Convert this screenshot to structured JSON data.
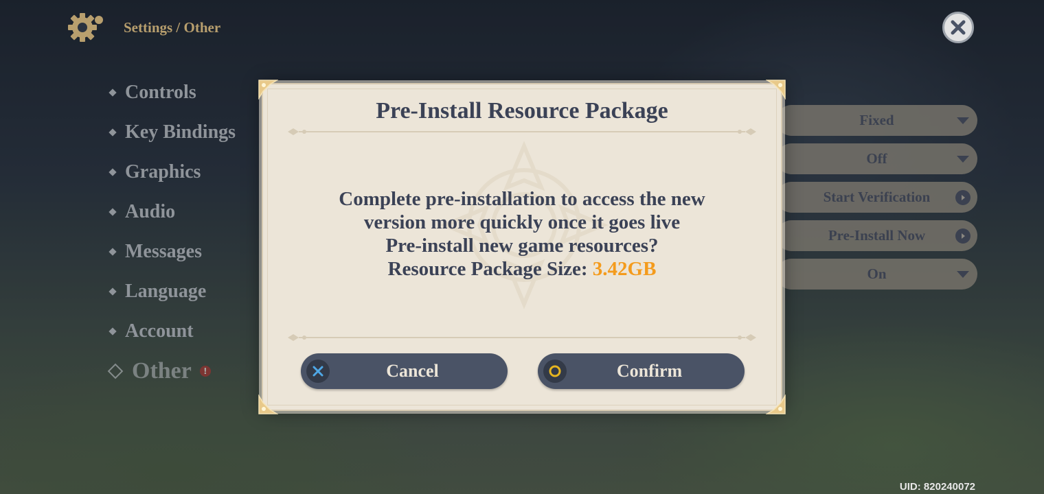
{
  "header": {
    "breadcrumb": "Settings / Other",
    "icon": "gear-icon",
    "close_icon": "close-icon"
  },
  "sidebar": {
    "items": [
      {
        "label": "Controls"
      },
      {
        "label": "Key Bindings"
      },
      {
        "label": "Graphics"
      },
      {
        "label": "Audio"
      },
      {
        "label": "Messages"
      },
      {
        "label": "Language"
      },
      {
        "label": "Account"
      },
      {
        "label": "Other",
        "active": true,
        "alert": "!"
      }
    ]
  },
  "settings": {
    "rows": [
      {
        "value": "Fixed",
        "control": "dropdown"
      },
      {
        "value": "Off",
        "control": "dropdown"
      },
      {
        "value": "Start Verification",
        "control": "action"
      },
      {
        "value": "Pre-Install Now",
        "control": "action"
      },
      {
        "value": "On",
        "control": "dropdown"
      }
    ]
  },
  "dialog": {
    "title": "Pre-Install Resource Package",
    "message_line1": "Complete pre-installation to access the new",
    "message_line2": "version more quickly once it goes live",
    "message_line3": "Pre-install new game resources?",
    "size_label": "Resource Package Size:",
    "size_value": "3.42GB",
    "cancel_label": "Cancel",
    "confirm_label": "Confirm"
  },
  "footer": {
    "uid": "UID: 820240072"
  },
  "colors": {
    "accent": "#f49b1c",
    "dialog_bg": "#ece5d8",
    "button_bg": "#4a5366",
    "text_dark": "#3b4256",
    "cancel_icon": "#4fa8e6",
    "confirm_icon": "#e6b520"
  }
}
